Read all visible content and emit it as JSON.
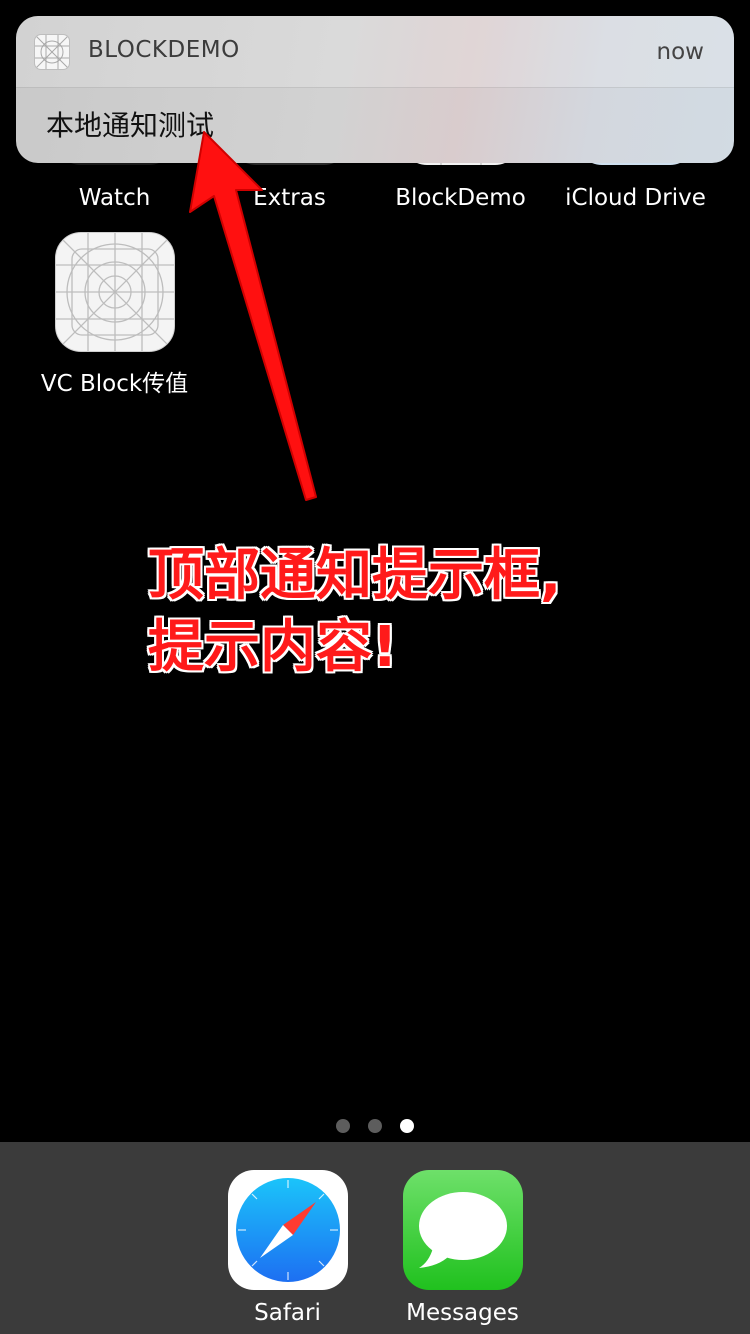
{
  "home_screen": {
    "top_row": [
      {
        "name": "Watch"
      },
      {
        "name": "Extras"
      },
      {
        "name": "BlockDemo"
      },
      {
        "name": "iCloud Drive"
      }
    ],
    "second_row": [
      {
        "name": "VC Block传值"
      }
    ]
  },
  "notification": {
    "app_name": "BLOCKDEMO",
    "time": "now",
    "body": "本地通知测试",
    "icon": "app-template-icon"
  },
  "annotation": {
    "line1": "顶部通知提示框,",
    "line2": "提示内容!",
    "color": "#ff1a1a"
  },
  "page_indicator": {
    "total": 3,
    "current": 3
  },
  "dock": {
    "apps": [
      {
        "name": "Safari",
        "icon": "safari-compass-icon"
      },
      {
        "name": "Messages",
        "icon": "messages-bubble-icon"
      }
    ]
  }
}
